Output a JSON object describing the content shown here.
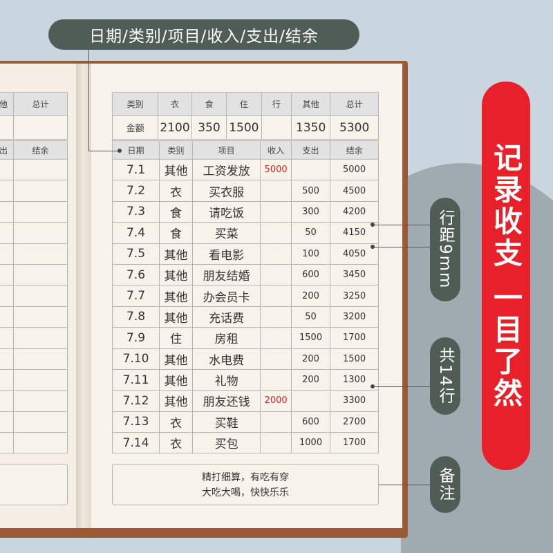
{
  "top_label": "日期/类别/项目/收入/支出/结余",
  "banner": "记录收支 一目了然",
  "callouts": {
    "line_spacing": "行距9mm",
    "rows": "共14行",
    "notes": "备注"
  },
  "left_page": {
    "summary_headers": [
      "他",
      "总计"
    ],
    "table_headers": [
      "出",
      "结余"
    ]
  },
  "summary": {
    "headers": [
      "类别",
      "衣",
      "食",
      "住",
      "行",
      "其他",
      "总计"
    ],
    "row_label": "金额",
    "values": [
      "2100",
      "350",
      "1500",
      "",
      "1350",
      "5300"
    ]
  },
  "table": {
    "headers": [
      "日期",
      "类别",
      "项目",
      "收入",
      "支出",
      "结余"
    ],
    "rows": [
      {
        "date": "7.1",
        "cat": "其他",
        "item": "工资发放",
        "income": "5000",
        "expense": "",
        "balance": "5000"
      },
      {
        "date": "7.2",
        "cat": "衣",
        "item": "买衣服",
        "income": "",
        "expense": "500",
        "balance": "4500"
      },
      {
        "date": "7.3",
        "cat": "食",
        "item": "请吃饭",
        "income": "",
        "expense": "300",
        "balance": "4200"
      },
      {
        "date": "7.4",
        "cat": "食",
        "item": "买菜",
        "income": "",
        "expense": "50",
        "balance": "4150"
      },
      {
        "date": "7.5",
        "cat": "其他",
        "item": "看电影",
        "income": "",
        "expense": "100",
        "balance": "4050"
      },
      {
        "date": "7.6",
        "cat": "其他",
        "item": "朋友结婚",
        "income": "",
        "expense": "600",
        "balance": "3450"
      },
      {
        "date": "7.7",
        "cat": "其他",
        "item": "办会员卡",
        "income": "",
        "expense": "200",
        "balance": "3250"
      },
      {
        "date": "7.8",
        "cat": "其他",
        "item": "充话费",
        "income": "",
        "expense": "50",
        "balance": "3200"
      },
      {
        "date": "7.9",
        "cat": "住",
        "item": "房租",
        "income": "",
        "expense": "1500",
        "balance": "1700"
      },
      {
        "date": "7.10",
        "cat": "其他",
        "item": "水电费",
        "income": "",
        "expense": "200",
        "balance": "1500"
      },
      {
        "date": "7.11",
        "cat": "其他",
        "item": "礼物",
        "income": "",
        "expense": "200",
        "balance": "1300"
      },
      {
        "date": "7.12",
        "cat": "其他",
        "item": "朋友还钱",
        "income": "2000",
        "expense": "",
        "balance": "3300"
      },
      {
        "date": "7.13",
        "cat": "衣",
        "item": "买鞋",
        "income": "",
        "expense": "600",
        "balance": "2700"
      },
      {
        "date": "7.14",
        "cat": "衣",
        "item": "买包",
        "income": "",
        "expense": "1000",
        "balance": "1700"
      }
    ]
  },
  "notes": {
    "line1": "精打细算，有吃有穿",
    "line2": "大吃大喝，快快乐乐"
  },
  "colors": {
    "pill": "#505c56",
    "banner": "#e8202a",
    "income": "#e02020",
    "cover": "#9a5a36"
  }
}
